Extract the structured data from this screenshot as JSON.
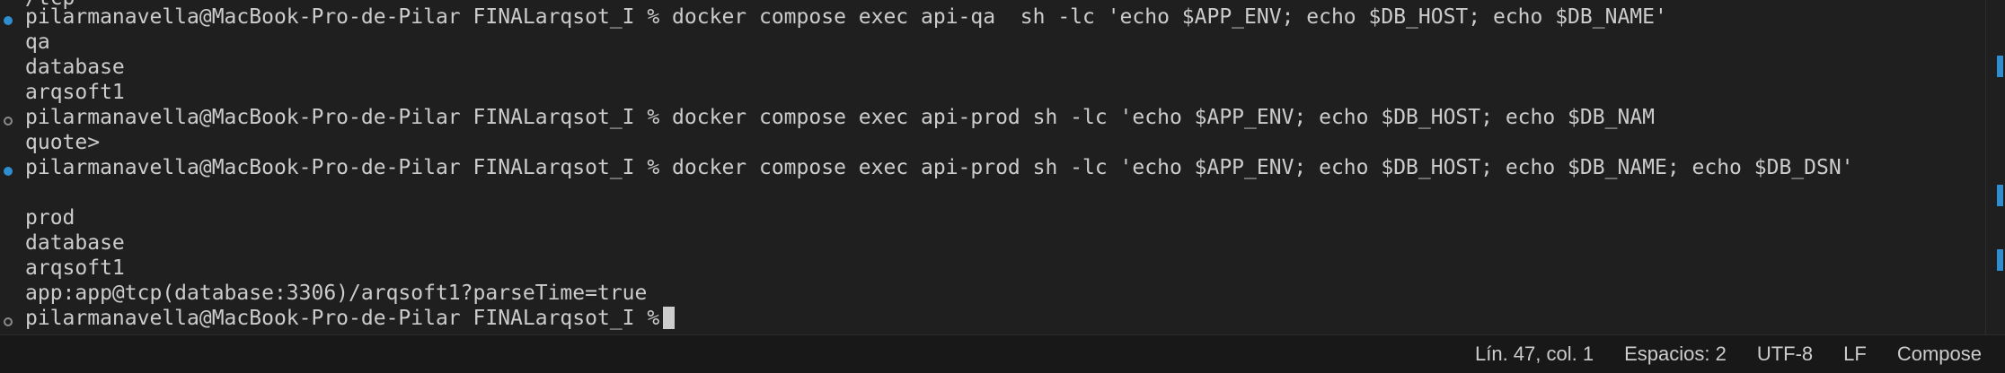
{
  "terminal": {
    "partial_top_line": "/tcp",
    "lines": [
      "pilarmanavella@MacBook-Pro-de-Pilar FINALarqsot_I % docker compose exec api-qa  sh -lc 'echo $APP_ENV; echo $DB_HOST; echo $DB_NAME'",
      "qa",
      "database",
      "arqsoft1",
      "pilarmanavella@MacBook-Pro-de-Pilar FINALarqsot_I % docker compose exec api-prod sh -lc 'echo $APP_ENV; echo $DB_HOST; echo $DB_NAM",
      "quote>",
      "pilarmanavella@MacBook-Pro-de-Pilar FINALarqsot_I % docker compose exec api-prod sh -lc 'echo $APP_ENV; echo $DB_HOST; echo $DB_NAME; echo $DB_DSN'",
      "",
      "prod",
      "database",
      "arqsoft1",
      "app:app@tcp(database:3306)/arqsoft1?parseTime=true",
      "pilarmanavella@MacBook-Pro-de-Pilar FINALarqsot_I %"
    ]
  },
  "statusbar": {
    "position": "Lín. 47, col. 1",
    "indentation": "Espacios: 2",
    "encoding": "UTF-8",
    "eol": "LF",
    "language": "Compose"
  },
  "colors": {
    "background": "#1f1f1f",
    "text": "#cccccc",
    "success_decoration": "#2f8ed0",
    "default_decoration": "#8a8a8a"
  }
}
